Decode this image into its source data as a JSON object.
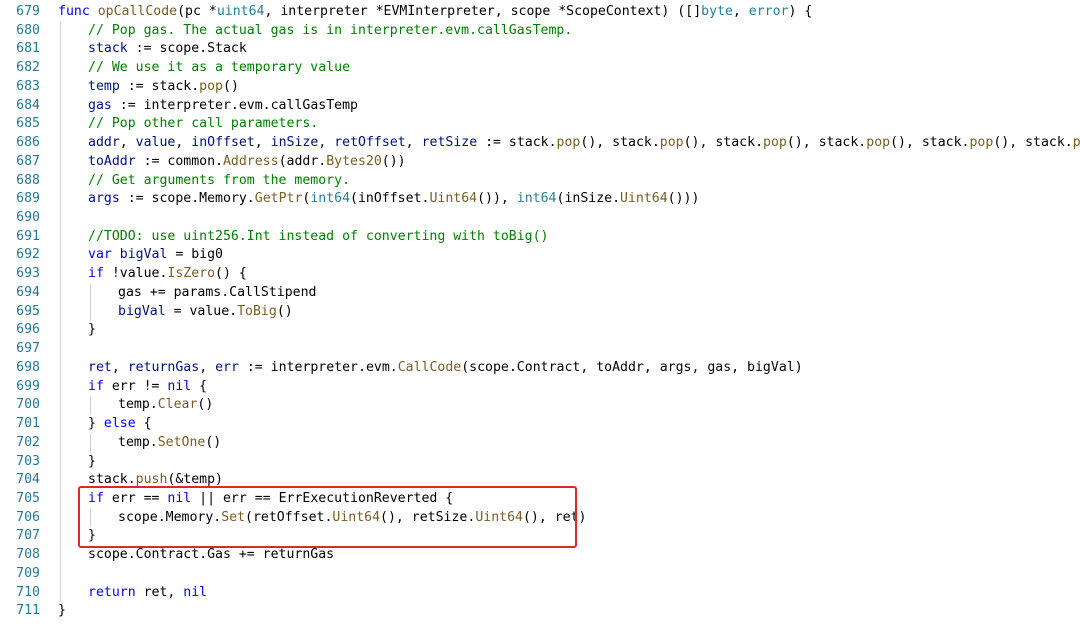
{
  "editor": {
    "lines": [
      {
        "num": "679",
        "indent": 0,
        "tokens": [
          {
            "t": "func ",
            "c": "kw"
          },
          {
            "t": "opCallCode",
            "c": "fn"
          },
          {
            "t": "(pc *",
            "c": "tx"
          },
          {
            "t": "uint64",
            "c": "ty"
          },
          {
            "t": ", interpreter *EVMInterpreter, scope *ScopeContext) ([]",
            "c": "tx"
          },
          {
            "t": "byte",
            "c": "ty"
          },
          {
            "t": ", ",
            "c": "tx"
          },
          {
            "t": "error",
            "c": "ty"
          },
          {
            "t": ") {",
            "c": "tx"
          }
        ]
      },
      {
        "num": "680",
        "indent": 1,
        "tokens": [
          {
            "t": "// Pop gas. The actual gas is in interpreter.evm.callGasTemp.",
            "c": "cm"
          }
        ]
      },
      {
        "num": "681",
        "indent": 1,
        "tokens": [
          {
            "t": "stack",
            "c": "id"
          },
          {
            "t": " := scope.Stack",
            "c": "tx"
          }
        ]
      },
      {
        "num": "682",
        "indent": 1,
        "tokens": [
          {
            "t": "// We use it as a temporary value",
            "c": "cm"
          }
        ]
      },
      {
        "num": "683",
        "indent": 1,
        "tokens": [
          {
            "t": "temp",
            "c": "id"
          },
          {
            "t": " := stack.",
            "c": "tx"
          },
          {
            "t": "pop",
            "c": "fn"
          },
          {
            "t": "()",
            "c": "tx"
          }
        ]
      },
      {
        "num": "684",
        "indent": 1,
        "tokens": [
          {
            "t": "gas",
            "c": "id"
          },
          {
            "t": " := interpreter.evm.callGasTemp",
            "c": "tx"
          }
        ]
      },
      {
        "num": "685",
        "indent": 1,
        "tokens": [
          {
            "t": "// Pop other call parameters.",
            "c": "cm"
          }
        ]
      },
      {
        "num": "686",
        "indent": 1,
        "tokens": [
          {
            "t": "addr",
            "c": "id"
          },
          {
            "t": ", ",
            "c": "tx"
          },
          {
            "t": "value",
            "c": "id"
          },
          {
            "t": ", ",
            "c": "tx"
          },
          {
            "t": "inOffset",
            "c": "id"
          },
          {
            "t": ", ",
            "c": "tx"
          },
          {
            "t": "inSize",
            "c": "id"
          },
          {
            "t": ", ",
            "c": "tx"
          },
          {
            "t": "retOffset",
            "c": "id"
          },
          {
            "t": ", ",
            "c": "tx"
          },
          {
            "t": "retSize",
            "c": "id"
          },
          {
            "t": " := stack.",
            "c": "tx"
          },
          {
            "t": "pop",
            "c": "fn"
          },
          {
            "t": "(), stack.",
            "c": "tx"
          },
          {
            "t": "pop",
            "c": "fn"
          },
          {
            "t": "(), stack.",
            "c": "tx"
          },
          {
            "t": "pop",
            "c": "fn"
          },
          {
            "t": "(), stack.",
            "c": "tx"
          },
          {
            "t": "pop",
            "c": "fn"
          },
          {
            "t": "(), stack.",
            "c": "tx"
          },
          {
            "t": "pop",
            "c": "fn"
          },
          {
            "t": "(), stack.",
            "c": "tx"
          },
          {
            "t": "pop",
            "c": "fn"
          },
          {
            "t": "()",
            "c": "tx"
          }
        ]
      },
      {
        "num": "687",
        "indent": 1,
        "tokens": [
          {
            "t": "toAddr",
            "c": "id"
          },
          {
            "t": " := common.",
            "c": "tx"
          },
          {
            "t": "Address",
            "c": "fn"
          },
          {
            "t": "(addr.",
            "c": "tx"
          },
          {
            "t": "Bytes20",
            "c": "fn"
          },
          {
            "t": "())",
            "c": "tx"
          }
        ]
      },
      {
        "num": "688",
        "indent": 1,
        "tokens": [
          {
            "t": "// Get arguments from the memory.",
            "c": "cm"
          }
        ]
      },
      {
        "num": "689",
        "indent": 1,
        "tokens": [
          {
            "t": "args",
            "c": "id"
          },
          {
            "t": " := scope.Memory.",
            "c": "tx"
          },
          {
            "t": "GetPtr",
            "c": "fn"
          },
          {
            "t": "(",
            "c": "tx"
          },
          {
            "t": "int64",
            "c": "ty"
          },
          {
            "t": "(inOffset.",
            "c": "tx"
          },
          {
            "t": "Uint64",
            "c": "fn"
          },
          {
            "t": "()), ",
            "c": "tx"
          },
          {
            "t": "int64",
            "c": "ty"
          },
          {
            "t": "(inSize.",
            "c": "tx"
          },
          {
            "t": "Uint64",
            "c": "fn"
          },
          {
            "t": "()))",
            "c": "tx"
          }
        ]
      },
      {
        "num": "690",
        "indent": 1,
        "tokens": []
      },
      {
        "num": "691",
        "indent": 1,
        "tokens": [
          {
            "t": "//TODO: use uint256.Int instead of converting with toBig()",
            "c": "cm"
          }
        ]
      },
      {
        "num": "692",
        "indent": 1,
        "tokens": [
          {
            "t": "var ",
            "c": "kw"
          },
          {
            "t": "bigVal",
            "c": "id"
          },
          {
            "t": " = big0",
            "c": "tx"
          }
        ]
      },
      {
        "num": "693",
        "indent": 1,
        "tokens": [
          {
            "t": "if ",
            "c": "kw"
          },
          {
            "t": "!value.",
            "c": "tx"
          },
          {
            "t": "IsZero",
            "c": "fn"
          },
          {
            "t": "() {",
            "c": "tx"
          }
        ]
      },
      {
        "num": "694",
        "indent": 2,
        "tokens": [
          {
            "t": "gas += params.CallStipend",
            "c": "tx"
          }
        ]
      },
      {
        "num": "695",
        "indent": 2,
        "tokens": [
          {
            "t": "bigVal",
            "c": "id"
          },
          {
            "t": " = value.",
            "c": "tx"
          },
          {
            "t": "ToBig",
            "c": "fn"
          },
          {
            "t": "()",
            "c": "tx"
          }
        ]
      },
      {
        "num": "696",
        "indent": 1,
        "tokens": [
          {
            "t": "}",
            "c": "tx"
          }
        ]
      },
      {
        "num": "697",
        "indent": 1,
        "tokens": []
      },
      {
        "num": "698",
        "indent": 1,
        "tokens": [
          {
            "t": "ret",
            "c": "id"
          },
          {
            "t": ", ",
            "c": "tx"
          },
          {
            "t": "returnGas",
            "c": "id"
          },
          {
            "t": ", ",
            "c": "tx"
          },
          {
            "t": "err",
            "c": "id"
          },
          {
            "t": " := interpreter.evm.",
            "c": "tx"
          },
          {
            "t": "CallCode",
            "c": "fn"
          },
          {
            "t": "(scope.Contract, toAddr, args, gas, bigVal)",
            "c": "tx"
          }
        ]
      },
      {
        "num": "699",
        "indent": 1,
        "tokens": [
          {
            "t": "if ",
            "c": "kw"
          },
          {
            "t": "err != ",
            "c": "tx"
          },
          {
            "t": "nil",
            "c": "kw"
          },
          {
            "t": " {",
            "c": "tx"
          }
        ]
      },
      {
        "num": "700",
        "indent": 2,
        "tokens": [
          {
            "t": "temp.",
            "c": "tx"
          },
          {
            "t": "Clear",
            "c": "fn"
          },
          {
            "t": "()",
            "c": "tx"
          }
        ]
      },
      {
        "num": "701",
        "indent": 1,
        "tokens": [
          {
            "t": "} ",
            "c": "tx"
          },
          {
            "t": "else",
            "c": "kw"
          },
          {
            "t": " {",
            "c": "tx"
          }
        ]
      },
      {
        "num": "702",
        "indent": 2,
        "tokens": [
          {
            "t": "temp.",
            "c": "tx"
          },
          {
            "t": "SetOne",
            "c": "fn"
          },
          {
            "t": "()",
            "c": "tx"
          }
        ]
      },
      {
        "num": "703",
        "indent": 1,
        "tokens": [
          {
            "t": "}",
            "c": "tx"
          }
        ]
      },
      {
        "num": "704",
        "indent": 1,
        "tokens": [
          {
            "t": "stack.",
            "c": "tx"
          },
          {
            "t": "push",
            "c": "fn"
          },
          {
            "t": "(&temp)",
            "c": "tx"
          }
        ]
      },
      {
        "num": "705",
        "indent": 1,
        "tokens": [
          {
            "t": "if ",
            "c": "kw"
          },
          {
            "t": "err == ",
            "c": "tx"
          },
          {
            "t": "nil",
            "c": "kw"
          },
          {
            "t": " || err == ErrExecutionReverted {",
            "c": "tx"
          }
        ]
      },
      {
        "num": "706",
        "indent": 2,
        "tokens": [
          {
            "t": "scope.Memory.",
            "c": "tx"
          },
          {
            "t": "Set",
            "c": "fn"
          },
          {
            "t": "(retOffset.",
            "c": "tx"
          },
          {
            "t": "Uint64",
            "c": "fn"
          },
          {
            "t": "(), retSize.",
            "c": "tx"
          },
          {
            "t": "Uint64",
            "c": "fn"
          },
          {
            "t": "(), ret)",
            "c": "tx"
          }
        ]
      },
      {
        "num": "707",
        "indent": 1,
        "tokens": [
          {
            "t": "}",
            "c": "tx"
          }
        ]
      },
      {
        "num": "708",
        "indent": 1,
        "tokens": [
          {
            "t": "scope.Contract.Gas += returnGas",
            "c": "tx"
          }
        ]
      },
      {
        "num": "709",
        "indent": 1,
        "tokens": []
      },
      {
        "num": "710",
        "indent": 1,
        "tokens": [
          {
            "t": "return ",
            "c": "kw"
          },
          {
            "t": "ret, ",
            "c": "tx"
          },
          {
            "t": "nil",
            "c": "kw"
          }
        ]
      },
      {
        "num": "711",
        "indent": 0,
        "tokens": [
          {
            "t": "}",
            "c": "tx"
          }
        ]
      }
    ]
  },
  "highlight": {
    "color": "#e0262b",
    "start_line": "705",
    "end_line": "707"
  },
  "colors": {
    "background": "#ffffff",
    "line_number": "#237893",
    "keyword": "#0000ff",
    "function": "#795e26",
    "identifier": "#001080",
    "type": "#267f99",
    "comment": "#008000",
    "text": "#000000"
  }
}
